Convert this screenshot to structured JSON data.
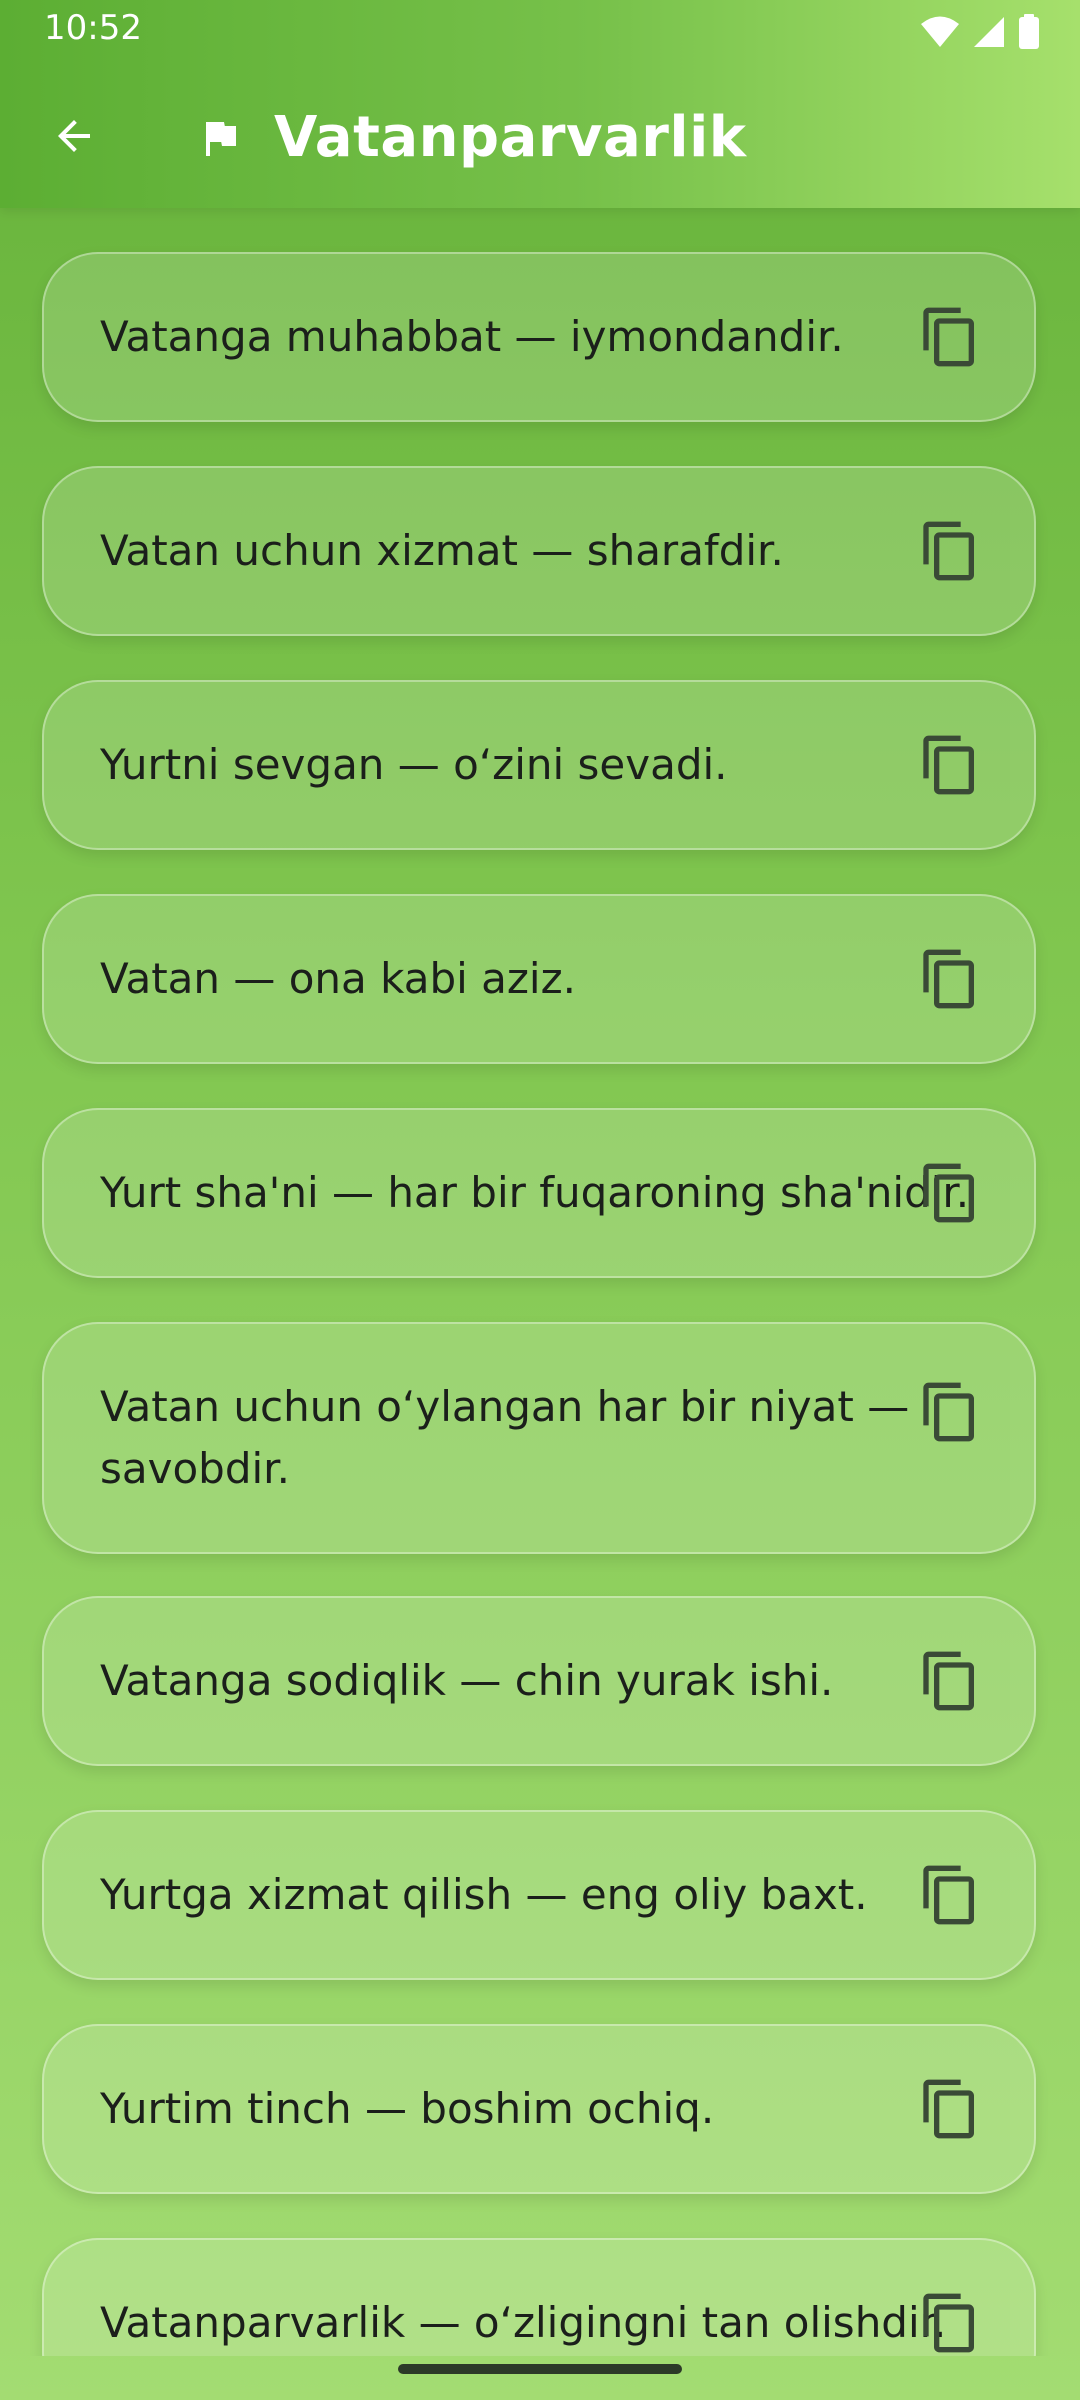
{
  "status_bar": {
    "time": "10:52"
  },
  "app_bar": {
    "title": "Vatanparvarlik"
  },
  "quotes": [
    "Vatanga muhabbat — iymondandir.",
    "Vatan uchun xizmat — sharafdir.",
    "Yurtni sevgan — o‘zini sevadi.",
    "Vatan — ona kabi aziz.",
    "Yurt sha'ni — har bir fuqaroning sha'nidir.",
    "Vatan uchun o‘ylangan har bir niyat — savobdir.",
    "Vatanga sodiqlik — chin yurak ishi.",
    "Yurtga xizmat qilish — eng oliy baxt.",
    "Yurtim tinch — boshim ochiq.",
    "Vatanparvarlik — o‘zligingni tan olishdir."
  ],
  "colors": {
    "gradient_top": "#66b23a",
    "gradient_bottom": "#a3dc72",
    "text": "#1b1f1b"
  },
  "icons": {
    "back": "arrow-left-icon",
    "flag": "flag-icon",
    "copy": "copy-icon"
  }
}
